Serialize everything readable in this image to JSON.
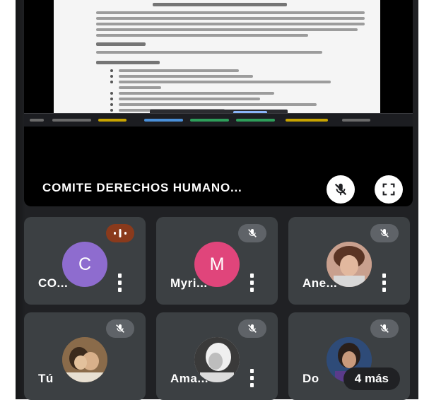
{
  "presentation": {
    "presenter_name": "COMITE DERECHOS HUMANO...",
    "buttons": {
      "mic_icon": "mic-off-icon",
      "fullscreen_icon": "fullscreen-icon"
    }
  },
  "participants": [
    {
      "name": "CO...",
      "initial": "C",
      "avatar_color": "#8e6ccf",
      "mic": "speaking",
      "has_menu": true
    },
    {
      "name": "Myri...",
      "initial": "M",
      "avatar_color": "#e0457b",
      "mic": "muted",
      "has_menu": true
    },
    {
      "name": "Ane...",
      "initial": "",
      "avatar_color": "#c98f7a",
      "mic": "muted",
      "has_menu": true
    },
    {
      "name": "Tú",
      "initial": "",
      "avatar_color": "#6d5a3f",
      "mic": "muted",
      "has_menu": false
    },
    {
      "name": "Ama...",
      "initial": "",
      "avatar_color": "#d9d9d9",
      "mic": "muted",
      "has_menu": true
    },
    {
      "name": "Do",
      "initial": "",
      "avatar_color": "#2e4b78",
      "mic": "muted",
      "has_menu": false
    }
  ],
  "overflow": {
    "label": "4 más"
  },
  "colors": {
    "app_background": "#202124",
    "tile_background": "#3c4043",
    "mic_muted_bg": "#5f6368",
    "mic_speaking_bg": "#8a3a1c"
  }
}
